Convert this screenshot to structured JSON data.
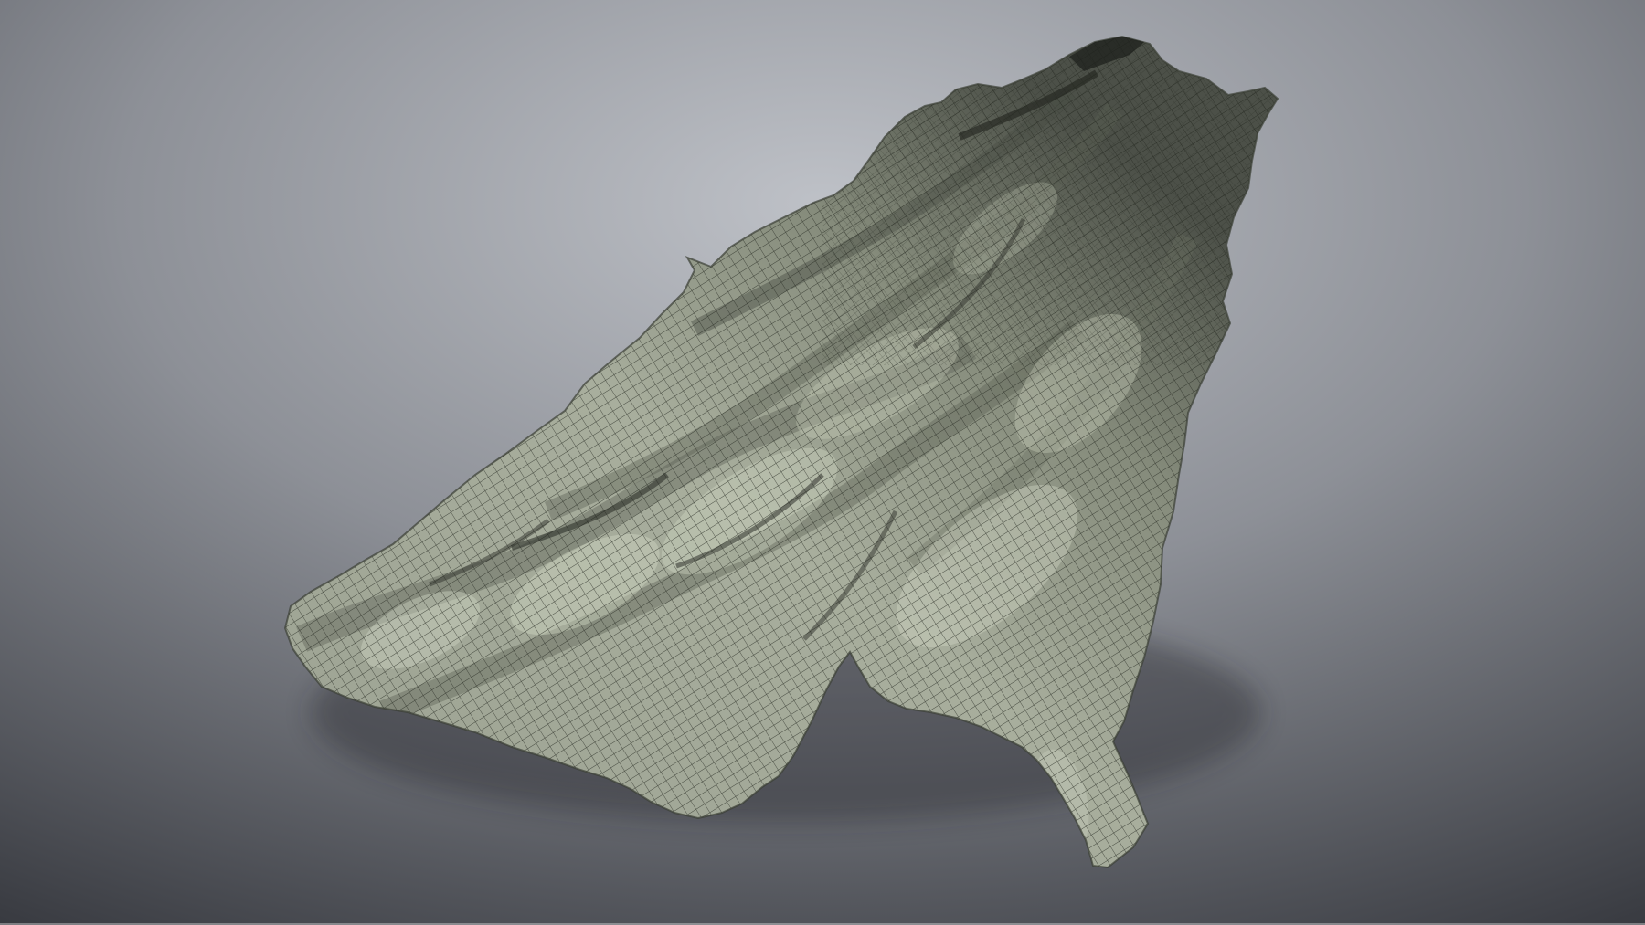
{
  "scene": {
    "subject": "rock-mesh-wireframe",
    "colors": {
      "background_top": "#bec1c7",
      "background_mid": "#8d9097",
      "background_bottom": "#34363c",
      "rock_light": "#c3c9b6",
      "rock_mid": "#8f9585",
      "rock_dark": "#4c5048",
      "wire": "#242820"
    }
  }
}
